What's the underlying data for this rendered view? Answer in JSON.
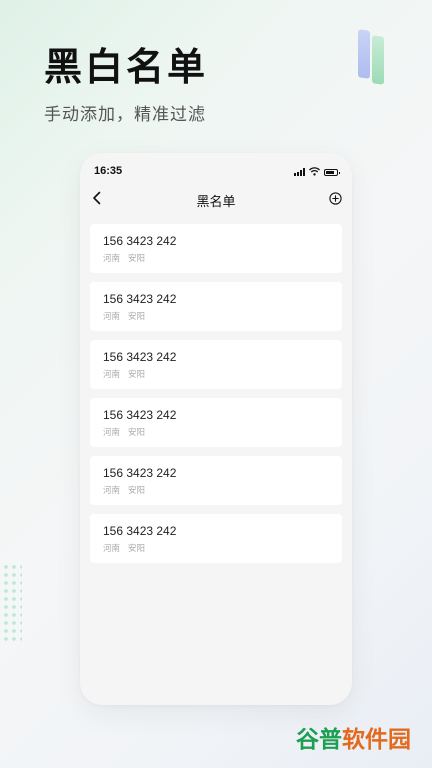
{
  "promo": {
    "title": "黑白名单",
    "subtitle": "手动添加，精准过滤"
  },
  "status_bar": {
    "time": "16:35"
  },
  "nav": {
    "title": "黑名单",
    "back_icon": "chevron-left-icon",
    "add_icon": "plus-circle-icon"
  },
  "blacklist": {
    "items": [
      {
        "number": "156 3423 242",
        "province": "河南",
        "city": "安阳"
      },
      {
        "number": "156 3423 242",
        "province": "河南",
        "city": "安阳"
      },
      {
        "number": "156 3423 242",
        "province": "河南",
        "city": "安阳"
      },
      {
        "number": "156 3423 242",
        "province": "河南",
        "city": "安阳"
      },
      {
        "number": "156 3423 242",
        "province": "河南",
        "city": "安阳"
      },
      {
        "number": "156 3423 242",
        "province": "河南",
        "city": "安阳"
      }
    ]
  },
  "watermark": {
    "part1": "谷普",
    "part2": "软件园"
  },
  "colors": {
    "accent_green": "#1e9e52",
    "accent_orange": "#e36a1c",
    "card_bg": "#ffffff",
    "screen_bg": "#f5f5f5"
  }
}
